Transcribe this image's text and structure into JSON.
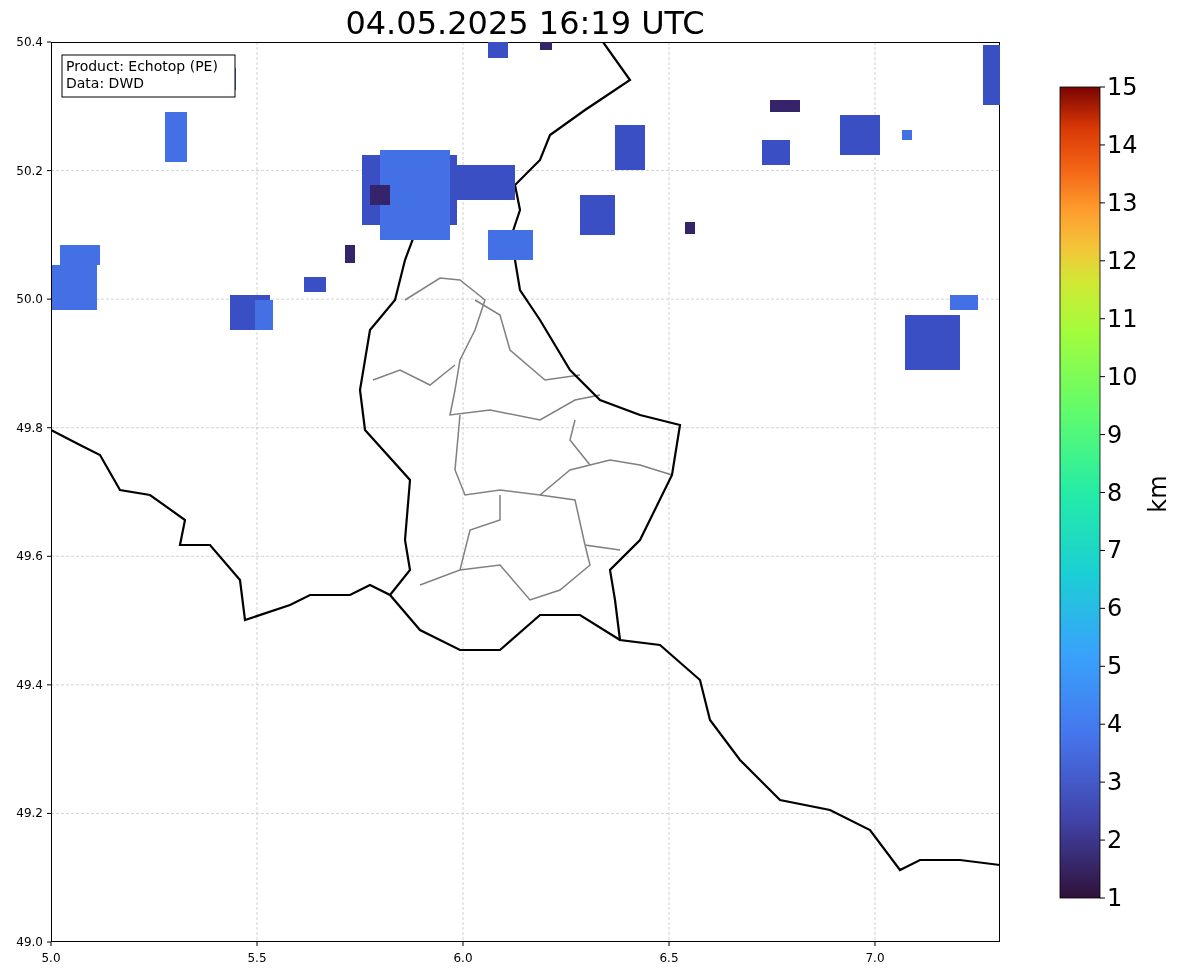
{
  "title": "04.05.2025 16:19 UTC",
  "legend": {
    "lines": [
      "Product: Echotop (PE)",
      "Data: DWD"
    ]
  },
  "x_axis": {
    "ticks": [
      "5.0",
      "5.5",
      "6.0",
      "6.5",
      "7.0"
    ]
  },
  "y_axis": {
    "ticks": [
      "50.4",
      "50.2",
      "50.0",
      "49.8",
      "49.6",
      "49.4",
      "49.2",
      "49.0"
    ]
  },
  "colorbar": {
    "label": "km",
    "ticks": [
      "15",
      "14",
      "13",
      "12",
      "11",
      "10",
      "9",
      "8",
      "7",
      "6",
      "5",
      "4",
      "3",
      "2",
      "1"
    ]
  }
}
